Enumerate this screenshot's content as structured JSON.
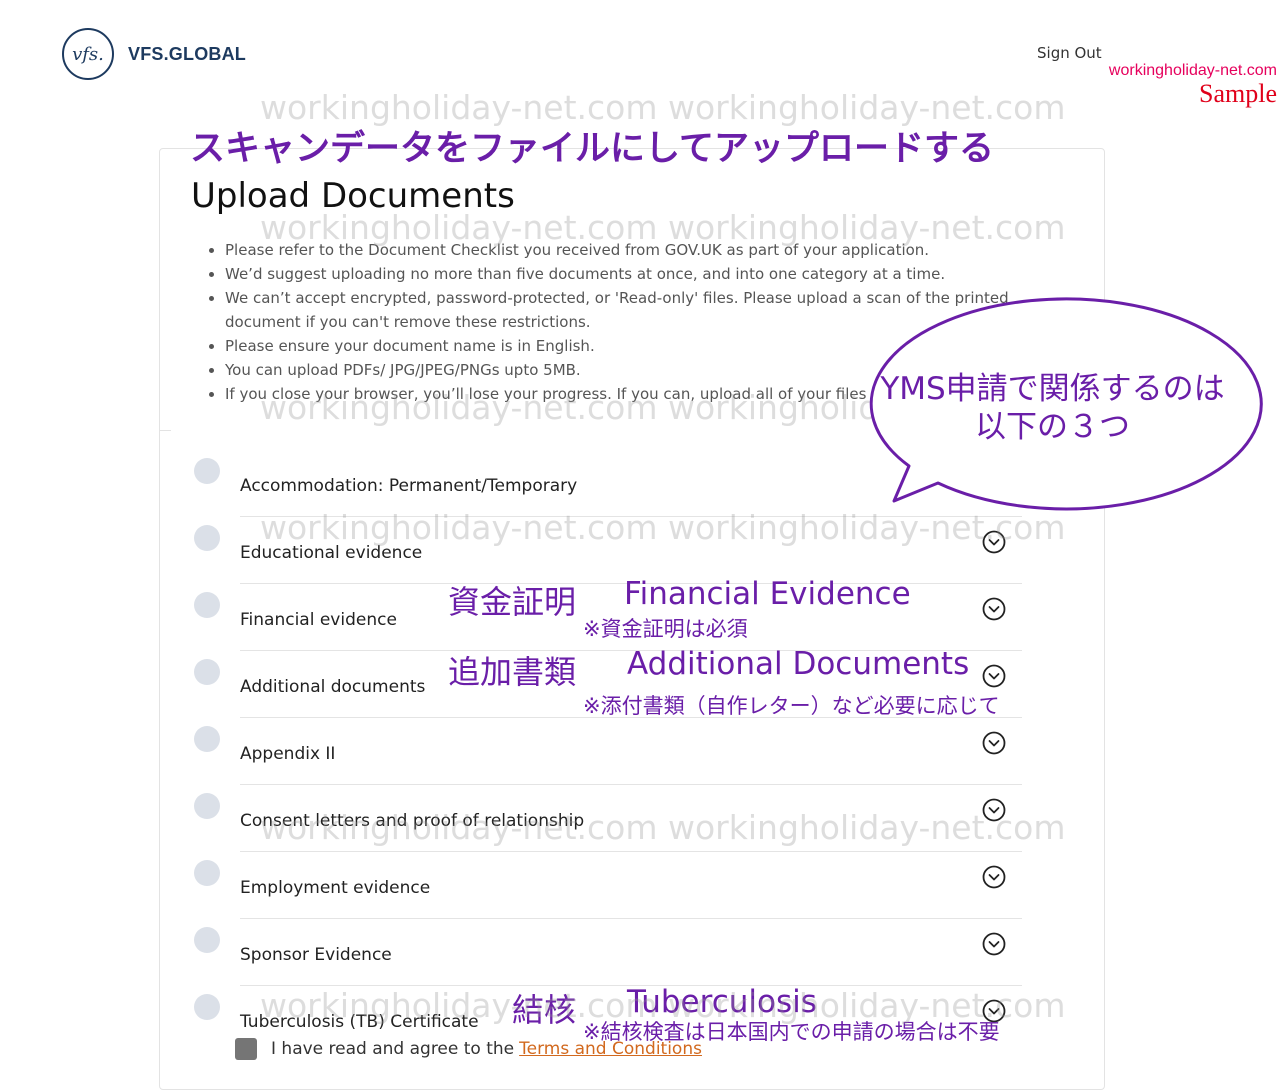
{
  "header": {
    "logo_mark": "vfs.",
    "logo_text": "VFS.GLOBAL",
    "sign_out": "Sign Out",
    "site_credit": "workingholiday-net.com",
    "sample_tag": "Sample"
  },
  "watermark": "workingholiday-net.com",
  "annotation_heading": "スキャンデータをファイルにしてアップロードする",
  "page_title": "Upload Documents",
  "notes": [
    "Please refer to the Document Checklist you received from GOV.UK as part of your application.",
    "We’d suggest uploading no more than five documents at once, and into one category at a time.",
    "We can’t accept encrypted, password-protected, or 'Read-only' files. Please upload a scan of the printed document if you can't remove these restrictions.",
    "Please ensure your document name is in English.",
    "You can upload PDFs/ JPG/JPEG/PNGs upto 5MB.",
    "If you close your browser, you’ll lose your progress. If you can, upload all of your files in one go."
  ],
  "categories": [
    {
      "label": "Accommodation: Permanent/Temporary"
    },
    {
      "label": "Educational evidence"
    },
    {
      "label": "Financial evidence"
    },
    {
      "label": "Additional documents"
    },
    {
      "label": "Appendix II"
    },
    {
      "label": "Consent letters and proof of relationship"
    },
    {
      "label": "Employment evidence"
    },
    {
      "label": "Sponsor Evidence"
    },
    {
      "label": "Tuberculosis (TB) Certificate"
    }
  ],
  "annotations": {
    "financial_jp": "資金証明",
    "financial_en": "Financial Evidence",
    "financial_note": "※資金証明は必須",
    "additional_jp": "追加書類",
    "additional_en": "Additional Documents",
    "additional_note": "※添付書類（自作レター）など必要に応じて",
    "tb_jp": "結核",
    "tb_en": "Tuberculosis",
    "tb_note": "※結核検査は日本国内での申請の場合は不要"
  },
  "bubble": {
    "line1": "YMS申請で関係するのは",
    "line2": "以下の３つ"
  },
  "agreement": {
    "text": "I have read and agree to the",
    "link": "Terms and Conditions"
  },
  "colors": {
    "annotation_purple": "#6a1ea8",
    "brand_navy": "#1d3a5f",
    "link_orange": "#d2691e",
    "credit_pink": "#e6005c"
  }
}
